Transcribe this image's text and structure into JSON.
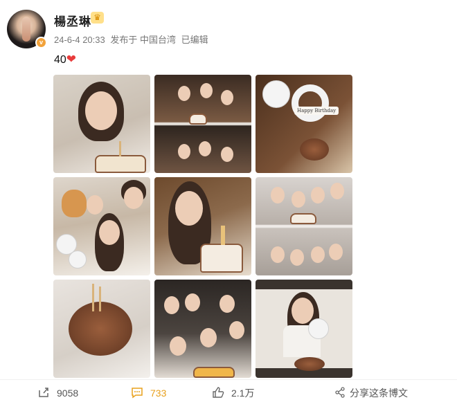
{
  "post": {
    "username": "楊丞琳",
    "meta": {
      "date": "24-6-4 20:33",
      "location": "发布于 中国台湾",
      "edited": "已编辑"
    },
    "text": "40",
    "text_emoji": "❤"
  },
  "actions": {
    "share_count": "9058",
    "comment_count": "733",
    "like_count": "2.1万",
    "share_label": "分享这条博文"
  },
  "photos": [
    {
      "text": ""
    },
    {
      "text": ""
    },
    {
      "text": "Happy Birthday"
    },
    {
      "text": ""
    },
    {
      "text": ""
    },
    {
      "text": ""
    },
    {
      "text": ""
    },
    {
      "text": ""
    },
    {
      "text": ""
    }
  ],
  "colors": {
    "accent_orange": "#e8a01c",
    "heart": "#e83b3b",
    "badge": "#f2a23a"
  }
}
